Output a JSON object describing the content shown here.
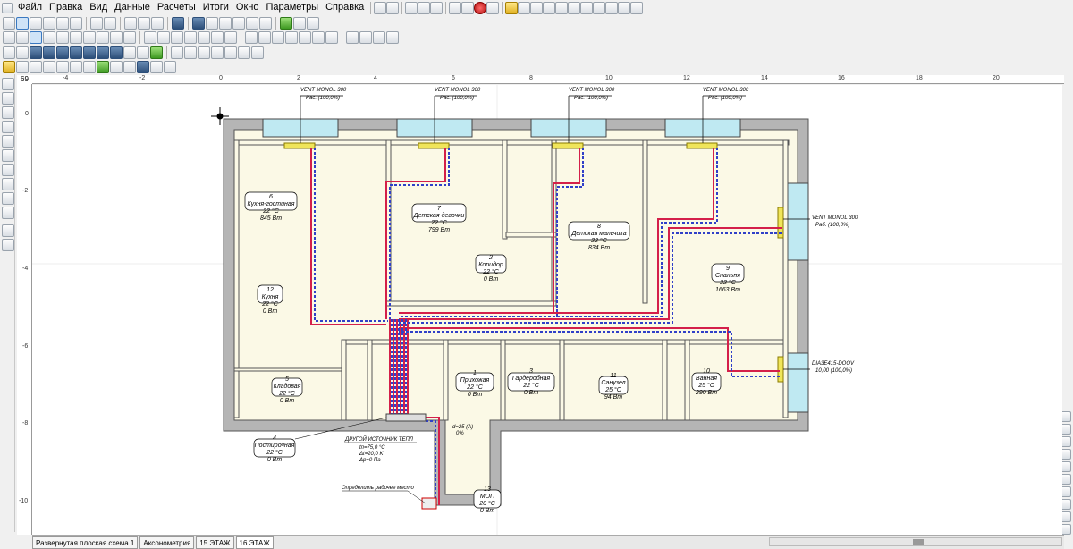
{
  "menu": {
    "items": [
      "Файл",
      "Правка",
      "Вид",
      "Данные",
      "Расчеты",
      "Итоги",
      "Окно",
      "Параметры",
      "Справка"
    ]
  },
  "ruler": {
    "corner": "69",
    "top_ticks": [
      "-4",
      "-2",
      "0",
      "2",
      "4",
      "6",
      "8",
      "10",
      "12",
      "14",
      "16",
      "18",
      "20"
    ],
    "left_ticks": [
      "0",
      "-2",
      "-4",
      "-6",
      "-8",
      "-10"
    ]
  },
  "plan": {
    "radiators": [
      {
        "model": "VENT MONOL 300",
        "power": "Рас. (100,0%)"
      },
      {
        "model": "VENT MONOL 300",
        "power": "Рас. (100,0%)"
      },
      {
        "model": "VENT MONOL 300",
        "power": "Рас. (100,0%)"
      },
      {
        "model": "VENT MONOL 300",
        "power": "Рас. (100,0%)"
      },
      {
        "model": "VENT MONOL 300",
        "power": "Раб. (100,0%)"
      },
      {
        "model": "DIA3E415-DOOV",
        "power": "10,00 (100,0%)"
      }
    ],
    "rooms": [
      {
        "num": "6",
        "name": "Кухня-гостиная",
        "temp": "22 °C",
        "load": "845 Вт"
      },
      {
        "num": "7",
        "name": "Детская девочки",
        "temp": "22 °C",
        "load": "799 Вт"
      },
      {
        "num": "8",
        "name": "Детская мальчика",
        "temp": "22 °C",
        "load": "834 Вт"
      },
      {
        "num": "9",
        "name": "Спальня",
        "temp": "22 °C",
        "load": "1663 Вт"
      },
      {
        "num": "2",
        "name": "Коридор",
        "temp": "22 °C",
        "load": "0 Вт"
      },
      {
        "num": "12",
        "name": "Кухня",
        "temp": "22 °C",
        "load": "0 Вт"
      },
      {
        "num": "5",
        "name": "Кладовая",
        "temp": "22 °C",
        "load": "0 Вт"
      },
      {
        "num": "1",
        "name": "Прихожая",
        "temp": "22 °C",
        "load": "0 Вт"
      },
      {
        "num": "3",
        "name": "Гардеробная",
        "temp": "22 °C",
        "load": "0 Вт"
      },
      {
        "num": "11",
        "name": "Санузел",
        "temp": "25 °C",
        "load": "94 Вт"
      },
      {
        "num": "10",
        "name": "Ванная",
        "temp": "25 °C",
        "load": "290 Вт"
      },
      {
        "num": "4",
        "name": "Постирочная",
        "temp": "22 °C",
        "load": "0 Вт"
      },
      {
        "num": "13",
        "name": "МОП",
        "temp": "20 °C",
        "load": "0 Вт"
      }
    ],
    "source": {
      "title": "ДРУГОЙ ИСТОЧНИК ТЕПЛ",
      "line1": "tп=75,0 °C",
      "line2": "Δt=20,0 K",
      "line3": "Δp=0 Па"
    },
    "flow_label": "d=25 (A)",
    "flow_sub": "0%",
    "note": "Определить рабочее место"
  },
  "tabs": [
    "Развернутая плоская схема 1",
    "Аксонометрия",
    "15 ЭТАЖ",
    "16 ЭТАЖ"
  ]
}
